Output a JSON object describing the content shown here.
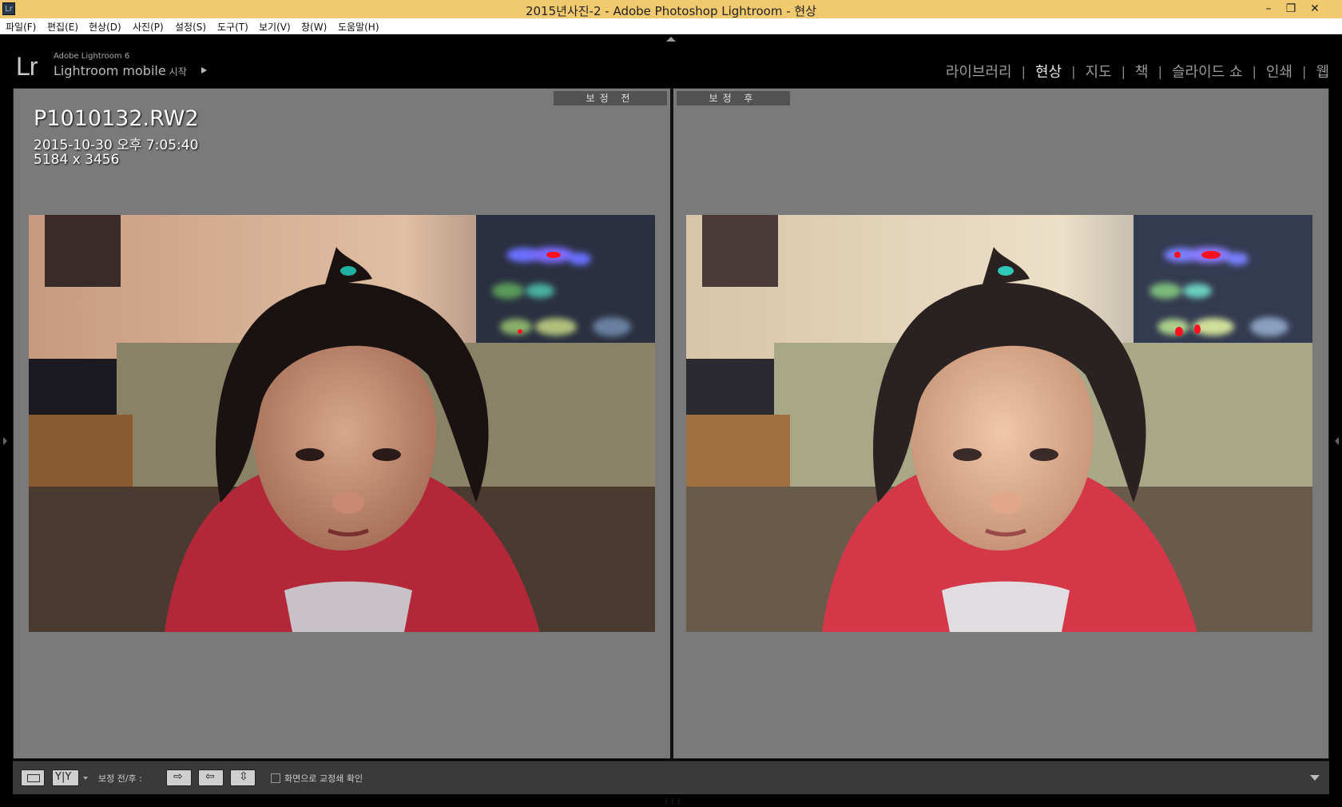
{
  "window": {
    "title": "2015년사진-2 - Adobe Photoshop Lightroom - 현상",
    "app_icon_text": "Lr",
    "controls": [
      "minimize-icon",
      "restore-icon",
      "close-icon"
    ]
  },
  "menu": [
    "파일(F)",
    "편집(E)",
    "현상(D)",
    "사진(P)",
    "설정(S)",
    "도구(T)",
    "보기(V)",
    "창(W)",
    "도움말(H)"
  ],
  "identity": {
    "logo": "Lr",
    "version": "Adobe Lightroom 6",
    "mobile": "Lightroom mobile",
    "mobile_sub": "시작"
  },
  "modules": [
    {
      "label": "라이브러리",
      "active": false
    },
    {
      "label": "현상",
      "active": true
    },
    {
      "label": "지도",
      "active": false
    },
    {
      "label": "책",
      "active": false
    },
    {
      "label": "슬라이드 쇼",
      "active": false
    },
    {
      "label": "인쇄",
      "active": false
    },
    {
      "label": "웹",
      "active": false
    }
  ],
  "view": {
    "before_label": "보정 전",
    "after_label": "보정 후",
    "filename": "P1010132.RW2",
    "datetime": "2015-10-30 오후 7:05:40",
    "dimensions": "5184 x 3456"
  },
  "toolbar": {
    "before_after_label": "보정 전/후 :",
    "checkbox_label": "화면으로 교정쇄 확인",
    "checkbox_checked": false
  },
  "colors": {
    "titlebar": "#f1c96e",
    "panel_bg": "#7a7a7a",
    "toolbar_bg": "#3a3a3a"
  }
}
